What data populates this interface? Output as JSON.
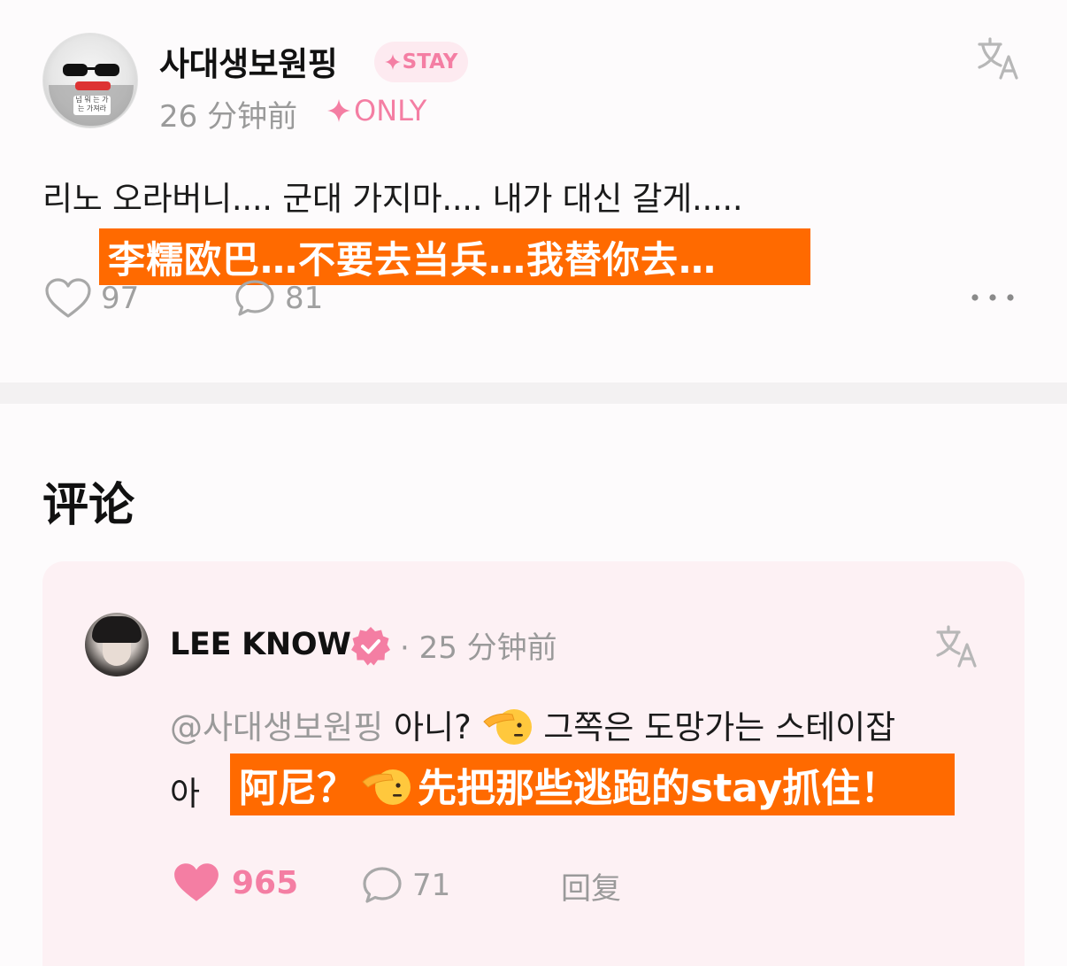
{
  "post": {
    "username": "사대생보원핑",
    "badge": "STAY",
    "time": "26 分钟前",
    "audience": "ONLY",
    "avatar_tag": "넘 뭐 는 가는\n가져라",
    "text": "리노 오라버니.... 군대 가지마.... 내가 대신 갈게.....",
    "translation_caption": "李糯欧巴…不要去当兵…我替你去…",
    "likes": "97",
    "comments": "81"
  },
  "comments_section": {
    "title": "评论"
  },
  "comment": {
    "username": "LEE KNOW",
    "time": "· 25 分钟前",
    "mention": "@사대생보원핑",
    "text_part1": " 아니? ",
    "text_part2": " 그쪽은 도망가는 스테이잡",
    "text_line2": "아",
    "caption_before": "阿尼？",
    "caption_after": "先把那些逃跑的stay抓住！",
    "likes": "965",
    "replies_count": "71",
    "reply_label": "回复"
  },
  "colors": {
    "accent_pink": "#f47ea3",
    "caption_orange": "#ff6a00",
    "muted_gray": "#9a9a9a",
    "card_bg": "#fdf1f4"
  },
  "icons": [
    "translate-icon",
    "heart-icon",
    "comment-bubble-icon",
    "more-icon",
    "verified-badge-icon",
    "saluting-face-emoji",
    "sparkle-icon"
  ]
}
